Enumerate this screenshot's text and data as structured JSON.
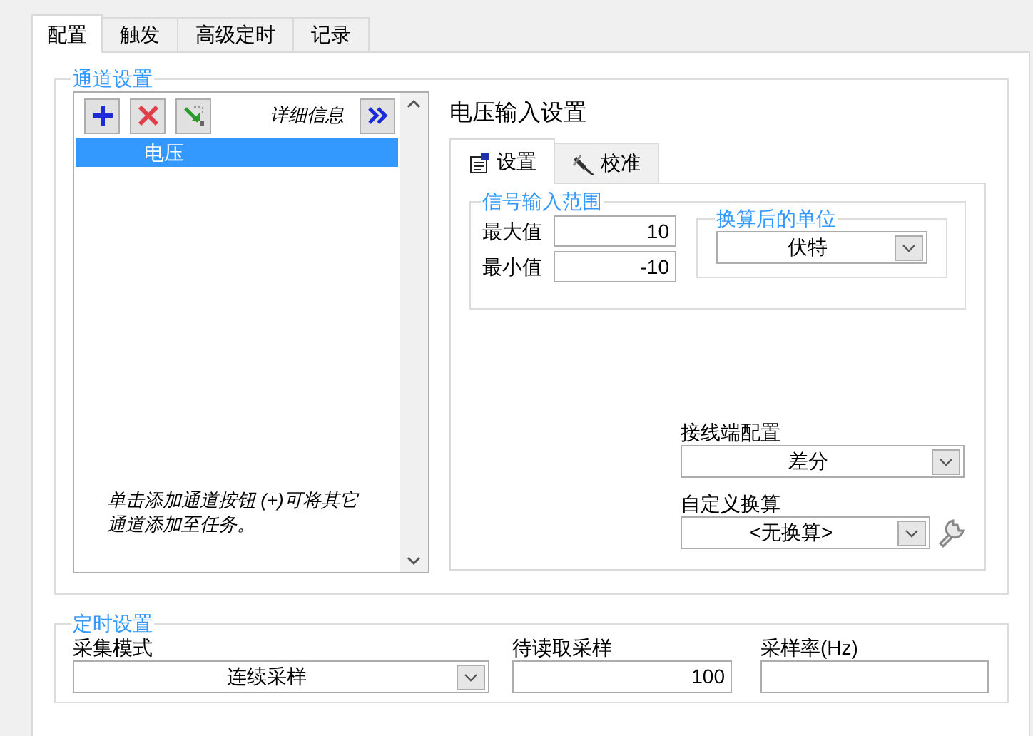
{
  "tabs": [
    {
      "label": "配置",
      "selected": true
    },
    {
      "label": "触发",
      "selected": false
    },
    {
      "label": "高级定时",
      "selected": false
    },
    {
      "label": "记录",
      "selected": false
    }
  ],
  "channel_settings": {
    "title": "通道设置",
    "details_label": "详细信息",
    "channels": [
      {
        "label": "电压",
        "selected": true
      }
    ],
    "hint": "单击添加通道按钮 (+)可将其它通道添加至任务。"
  },
  "voltage_settings": {
    "title": "电压输入设置",
    "tabs": [
      {
        "label": "设置",
        "selected": true
      },
      {
        "label": "校准",
        "selected": false
      }
    ],
    "signal_range": {
      "title": "信号输入范围",
      "fields": [
        {
          "label": "最大值",
          "value": "10"
        },
        {
          "label": "最小值",
          "value": "-10"
        }
      ]
    },
    "scaled_units": {
      "title": "换算后的单位",
      "value": "伏特"
    },
    "terminal_config": {
      "label": "接线端配置",
      "value": "差分"
    },
    "custom_scaling": {
      "label": "自定义换算",
      "value": "<无换算>"
    }
  },
  "timing_settings": {
    "title": "定时设置",
    "acquisition_mode": {
      "label": "采集模式",
      "value": "连续采样"
    },
    "samples_to_read": {
      "label": "待读取采样",
      "value": "100"
    },
    "rate": {
      "label": "采样率(Hz)"
    }
  }
}
